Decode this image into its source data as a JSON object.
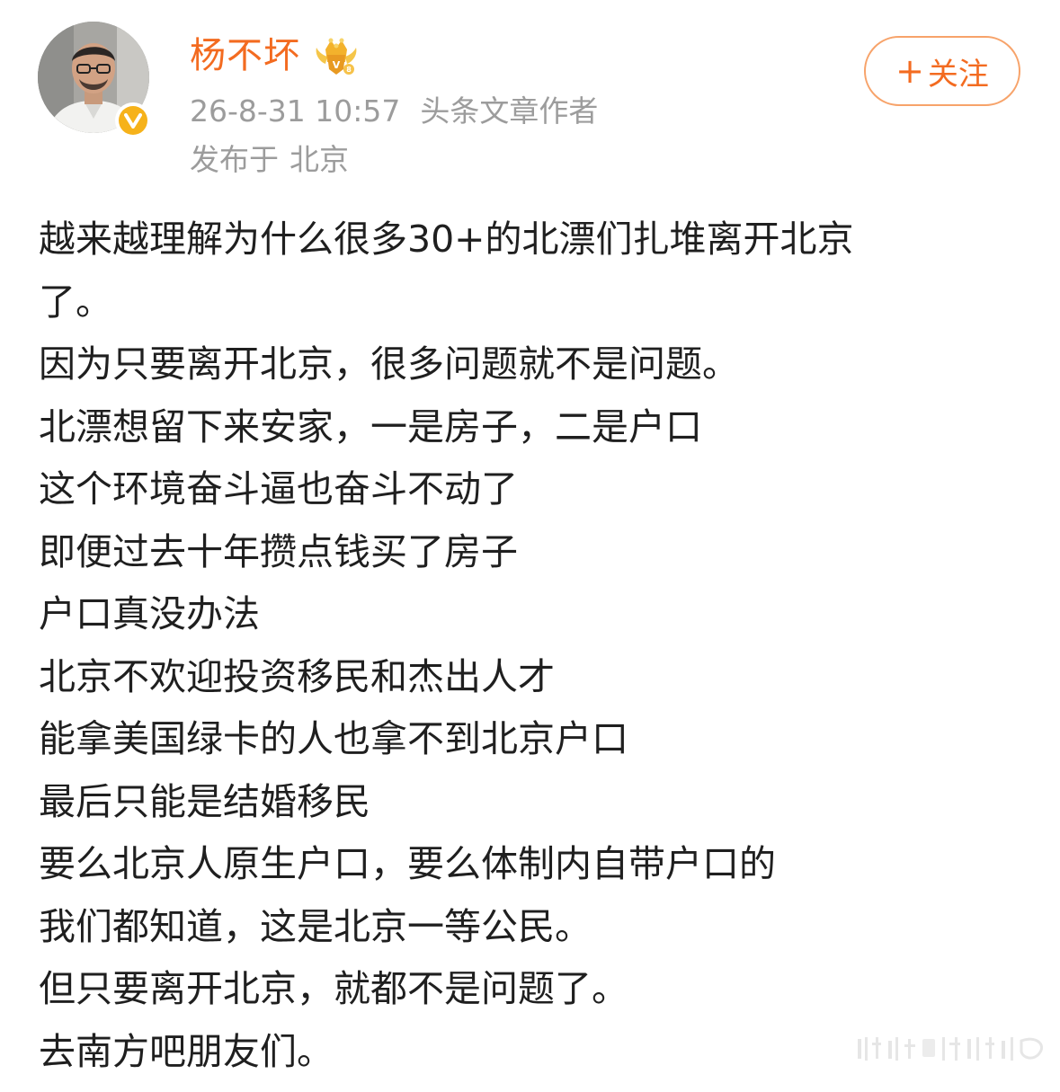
{
  "author": {
    "name": "杨不坏",
    "avatar_icon": "avatar",
    "verified_icon": "verified-badge-icon",
    "vip_icon": "vip-crown-icon"
  },
  "post_meta": {
    "timestamp": "26-8-31 10:57",
    "source": "头条文章作者",
    "location_label": "发布于",
    "location": "北京"
  },
  "follow_button": {
    "plus": "+",
    "label": "关注"
  },
  "content": {
    "lines": [
      "越来越理解为什么很多30+的北漂们扎堆离开北京",
      "了。",
      "因为只要离开北京，很多问题就不是问题。",
      "北漂想留下来安家，一是房子，二是户口",
      "这个环境奋斗逼也奋斗不动了",
      "即便过去十年攒点钱买了房子",
      "户口真没办法",
      "北京不欢迎投资移民和杰出人才",
      "能拿美国绿卡的人也拿不到北京户口",
      "最后只能是结婚移民",
      "要么北京人原生户口，要么体制内自带户口的",
      "我们都知道，这是北京一等公民。",
      "但只要离开北京，就都不是问题了。",
      "去南方吧朋友们。"
    ]
  },
  "colors": {
    "accent": "#f36b20",
    "follow_border": "#f7a36a",
    "meta_text": "#9c9c9c",
    "body_text": "#1f1f1f",
    "verified": "#f6b21a"
  }
}
